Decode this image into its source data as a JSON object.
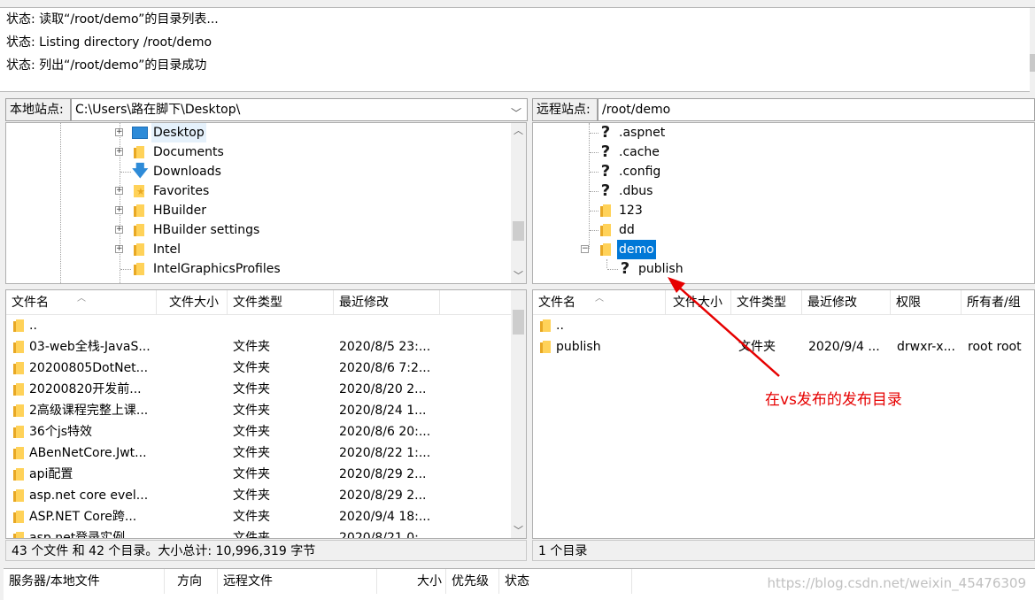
{
  "log": {
    "lines": [
      "状态: 读取“/root/demo”的目录列表...",
      "状态: Listing directory /root/demo",
      "状态: 列出“/root/demo”的目录成功"
    ]
  },
  "local": {
    "label": "本地站点:",
    "path": "C:\\Users\\路在脚下\\Desktop\\",
    "tree": [
      {
        "name": "Desktop",
        "icon": "desktop-icon",
        "expandable": true,
        "selected": true
      },
      {
        "name": "Documents",
        "icon": "folder-icon",
        "expandable": true
      },
      {
        "name": "Downloads",
        "icon": "download-icon",
        "expandable": false
      },
      {
        "name": "Favorites",
        "icon": "star-folder-icon",
        "expandable": true
      },
      {
        "name": "HBuilder",
        "icon": "folder-icon",
        "expandable": true
      },
      {
        "name": "HBuilder settings",
        "icon": "folder-icon",
        "expandable": true
      },
      {
        "name": "Intel",
        "icon": "folder-icon",
        "expandable": true
      },
      {
        "name": "IntelGraphicsProfiles",
        "icon": "folder-icon",
        "expandable": false
      }
    ],
    "columns": [
      "文件名",
      "文件大小",
      "文件类型",
      "最近修改"
    ],
    "files": [
      {
        "name": "..",
        "type": "",
        "modified": ""
      },
      {
        "name": "03-web全栈-JavaS...",
        "type": "文件夹",
        "modified": "2020/8/5 23:..."
      },
      {
        "name": "20200805DotNet...",
        "type": "文件夹",
        "modified": "2020/8/6 7:2..."
      },
      {
        "name": "20200820开发前...",
        "type": "文件夹",
        "modified": "2020/8/20 2..."
      },
      {
        "name": "2高级课程完整上课...",
        "type": "文件夹",
        "modified": "2020/8/24 1..."
      },
      {
        "name": "36个js特效",
        "type": "文件夹",
        "modified": "2020/8/6 20:..."
      },
      {
        "name": "ABenNetCore.Jwt...",
        "type": "文件夹",
        "modified": "2020/8/22 1:..."
      },
      {
        "name": "api配置",
        "type": "文件夹",
        "modified": "2020/8/29 2..."
      },
      {
        "name": "asp.net core evel...",
        "type": "文件夹",
        "modified": "2020/8/29 2..."
      },
      {
        "name": "ASP.NET Core跨...",
        "type": "文件夹",
        "modified": "2020/9/4 18:..."
      },
      {
        "name": "asp.net登录实例",
        "type": "文件夹",
        "modified": "2020/8/21 0:..."
      }
    ],
    "status": "43 个文件 和 42 个目录。大小总计: 10,996,319 字节"
  },
  "remote": {
    "label": "远程站点:",
    "path": "/root/demo",
    "tree": [
      {
        "name": ".aspnet",
        "icon": "question-icon"
      },
      {
        "name": ".cache",
        "icon": "question-icon"
      },
      {
        "name": ".config",
        "icon": "question-icon"
      },
      {
        "name": ".dbus",
        "icon": "question-icon"
      },
      {
        "name": "123",
        "icon": "folder-icon"
      },
      {
        "name": "dd",
        "icon": "folder-icon"
      },
      {
        "name": "demo",
        "icon": "folder-icon",
        "selected": true,
        "expanded": true
      },
      {
        "name": "publish",
        "icon": "question-icon",
        "child": true
      }
    ],
    "columns": [
      "文件名",
      "文件大小",
      "文件类型",
      "最近修改",
      "权限",
      "所有者/组"
    ],
    "files": [
      {
        "name": "..",
        "type": "",
        "modified": "",
        "perm": "",
        "owner": ""
      },
      {
        "name": "publish",
        "type": "文件夹",
        "modified": "2020/9/4 ...",
        "perm": "drwxr-x...",
        "owner": "root root"
      }
    ],
    "status": "1 个目录"
  },
  "queue": {
    "columns": [
      "服务器/本地文件",
      "方向",
      "远程文件",
      "大小",
      "优先级",
      "状态"
    ]
  },
  "annotation": {
    "text": "在vs发布的发布目录",
    "color": "#e60000"
  },
  "watermark": "https://blog.csdn.net/weixin_45476309"
}
